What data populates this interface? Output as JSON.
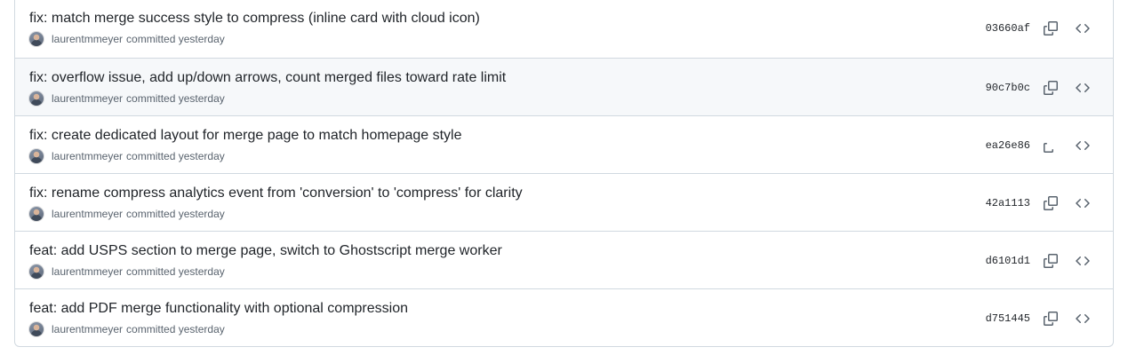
{
  "commits": [
    {
      "title": "fix: match merge success style to compress (inline card with cloud icon)",
      "author": "laurentmmeyer",
      "action": "committed",
      "time": "yesterday",
      "sha": "03660af"
    },
    {
      "title": "fix: overflow issue, add up/down arrows, count merged files toward rate limit",
      "author": "laurentmmeyer",
      "action": "committed",
      "time": "yesterday",
      "sha": "90c7b0c"
    },
    {
      "title": "fix: create dedicated layout for merge page to match homepage style",
      "author": "laurentmmeyer",
      "action": "committed",
      "time": "yesterday",
      "sha": "ea26e86"
    },
    {
      "title": "fix: rename compress analytics event from 'conversion' to 'compress' for clarity",
      "author": "laurentmmeyer",
      "action": "committed",
      "time": "yesterday",
      "sha": "42a1113"
    },
    {
      "title": "feat: add USPS section to merge page, switch to Ghostscript merge worker",
      "author": "laurentmmeyer",
      "action": "committed",
      "time": "yesterday",
      "sha": "d6101d1"
    },
    {
      "title": "feat: add PDF merge functionality with optional compression",
      "author": "laurentmmeyer",
      "action": "committed",
      "time": "yesterday",
      "sha": "d751445"
    }
  ],
  "icons": {
    "copy": "copy-icon",
    "browse": "code-icon"
  },
  "colors": {
    "border": "#d1d9e0",
    "hover_row": "#f6f8fa",
    "muted": "#59636e",
    "text": "#1f2328"
  }
}
